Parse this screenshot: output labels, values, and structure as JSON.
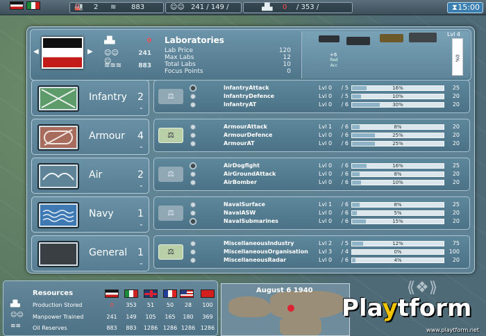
{
  "topbar": {
    "factories": "2",
    "oil": "883",
    "manpower": "241 / 149 /",
    "production_used": "0",
    "production_total": "/ 353 /",
    "clock": "15:00"
  },
  "header": {
    "stats": [
      {
        "icon": "factory-icon",
        "value": "0",
        "color": "#ff4a4a"
      },
      {
        "icon": "manpower-icon",
        "value": "241",
        "color": "#ffffff"
      },
      {
        "icon": "oil-icon",
        "value": "883",
        "color": "#ffffff"
      }
    ],
    "labs": {
      "title": "Laboratories",
      "rows": [
        {
          "label": "Lab Price",
          "value": "120"
        },
        {
          "label": "Max Labs",
          "value": "12"
        },
        {
          "label": "Total Labs",
          "value": "10"
        },
        {
          "label": "Focus Points",
          "value": "0"
        }
      ]
    },
    "level_label": "Lvl 4",
    "level_value": "%0",
    "plus_text": "+6",
    "red_acc": "Red Acc"
  },
  "categories": [
    {
      "name": "Infantry",
      "count": "2"
    },
    {
      "name": "Armour",
      "count": "4"
    },
    {
      "name": "Air",
      "count": "2"
    },
    {
      "name": "Navy",
      "count": "1"
    },
    {
      "name": "General",
      "count": "1"
    }
  ],
  "groups": [
    {
      "active": false,
      "techs": [
        {
          "name": "InfantryAttack",
          "lvl": "Lvl 0",
          "max": "/ 5",
          "pct": 16,
          "pct_label": "16%",
          "cost": "25",
          "selected": true
        },
        {
          "name": "InfantryDefence",
          "lvl": "Lvl 0",
          "max": "/ 5",
          "pct": 10,
          "pct_label": "10%",
          "cost": "20",
          "selected": false
        },
        {
          "name": "InfantryAT",
          "lvl": "Lvl 0",
          "max": "/ 6",
          "pct": 30,
          "pct_label": "30%",
          "cost": "20",
          "selected": false
        }
      ]
    },
    {
      "active": true,
      "techs": [
        {
          "name": "ArmourAttack",
          "lvl": "Lvl 1",
          "max": "/ 6",
          "pct": 8,
          "pct_label": "8%",
          "cost": "20",
          "selected": false
        },
        {
          "name": "ArmourDefence",
          "lvl": "Lvl 0",
          "max": "/ 6",
          "pct": 25,
          "pct_label": "25%",
          "cost": "20",
          "selected": false
        },
        {
          "name": "ArmourAT",
          "lvl": "Lvl 0",
          "max": "/ 6",
          "pct": 25,
          "pct_label": "25%",
          "cost": "20",
          "selected": false
        }
      ]
    },
    {
      "active": false,
      "techs": [
        {
          "name": "AirDogfight",
          "lvl": "Lvl 0",
          "max": "/ 6",
          "pct": 16,
          "pct_label": "16%",
          "cost": "25",
          "selected": true
        },
        {
          "name": "AirGroundAttack",
          "lvl": "Lvl 0",
          "max": "/ 6",
          "pct": 8,
          "pct_label": "8%",
          "cost": "20",
          "selected": false
        },
        {
          "name": "AirBomber",
          "lvl": "Lvl 0",
          "max": "/ 6",
          "pct": 10,
          "pct_label": "10%",
          "cost": "20",
          "selected": false
        }
      ]
    },
    {
      "active": false,
      "techs": [
        {
          "name": "NavalSurface",
          "lvl": "Lvl 1",
          "max": "/ 6",
          "pct": 8,
          "pct_label": "8%",
          "cost": "25",
          "selected": false
        },
        {
          "name": "NavalASW",
          "lvl": "Lvl 0",
          "max": "/ 6",
          "pct": 5,
          "pct_label": "5%",
          "cost": "20",
          "selected": false
        },
        {
          "name": "NavalSubmarines",
          "lvl": "Lvl 0",
          "max": "/ 6",
          "pct": 15,
          "pct_label": "15%",
          "cost": "20",
          "selected": true
        }
      ]
    },
    {
      "active": true,
      "techs": [
        {
          "name": "MiscellaneousIndustry",
          "lvl": "Lvl 2",
          "max": "/ 5",
          "pct": 12,
          "pct_label": "12%",
          "cost": "75",
          "selected": false
        },
        {
          "name": "MiscellaneousOrganisation",
          "lvl": "Lvl 3",
          "max": "/ 4",
          "pct": 0,
          "pct_label": "0%",
          "cost": "100",
          "selected": false
        },
        {
          "name": "MiscellaneousRadar",
          "lvl": "Lvl 0",
          "max": "/ 6",
          "pct": 4,
          "pct_label": "4%",
          "cost": "20",
          "selected": false
        }
      ]
    }
  ],
  "resources": {
    "title": "Resources",
    "rows": [
      {
        "label": "Production Stored",
        "values": [
          "0",
          "353",
          "51",
          "50",
          "28",
          "100"
        ]
      },
      {
        "label": "Manpower Trained",
        "values": [
          "241",
          "149",
          "105",
          "165",
          "180",
          "369"
        ]
      },
      {
        "label": "Oil Reserves",
        "values": [
          "883",
          "883",
          "1286",
          "1286",
          "1286",
          "1286"
        ]
      }
    ]
  },
  "minimap": {
    "date": "August 6 1940"
  },
  "watermark": {
    "brand_a": "Pla",
    "brand_b": "y",
    "brand_c": "tform",
    "url": "www.playtform.net"
  },
  "colors": {
    "accent": "#3b7fb1",
    "warning": "#ff4a4a",
    "panel": "#5e879c"
  }
}
